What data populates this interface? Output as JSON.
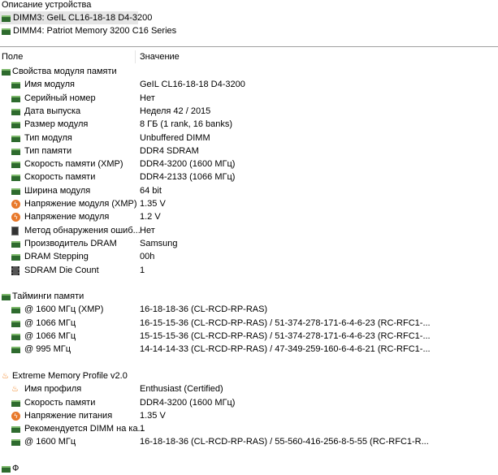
{
  "devices": {
    "title": "Описание устройства",
    "items": [
      "DIMM3: GeIL CL16-18-18 D4-3200",
      "DIMM4: Patriot Memory 3200 C16 Series"
    ],
    "selected": 0
  },
  "columns": {
    "field": "Поле",
    "value": "Значение"
  },
  "rows": [
    {
      "type": "sec",
      "icon": "ram",
      "field": "Свойства модуля памяти",
      "value": ""
    },
    {
      "type": "item",
      "icon": "ram",
      "field": "Имя модуля",
      "value": "GeIL CL16-18-18 D4-3200"
    },
    {
      "type": "item",
      "icon": "ram",
      "field": "Серийный номер",
      "value": "Нет"
    },
    {
      "type": "item",
      "icon": "ram",
      "field": "Дата выпуска",
      "value": "Неделя 42 / 2015"
    },
    {
      "type": "item",
      "icon": "ram",
      "field": "Размер модуля",
      "value": "8 ГБ (1 rank, 16 banks)"
    },
    {
      "type": "item",
      "icon": "ram",
      "field": "Тип модуля",
      "value": "Unbuffered DIMM"
    },
    {
      "type": "item",
      "icon": "ram",
      "field": "Тип памяти",
      "value": "DDR4 SDRAM"
    },
    {
      "type": "item",
      "icon": "ram",
      "field": "Скорость памяти (XMP)",
      "value": "DDR4-3200 (1600 МГц)"
    },
    {
      "type": "item",
      "icon": "ram",
      "field": "Скорость памяти",
      "value": "DDR4-2133 (1066 МГц)"
    },
    {
      "type": "item",
      "icon": "ram",
      "field": "Ширина модуля",
      "value": "64 bit"
    },
    {
      "type": "item",
      "icon": "bolt",
      "field": "Напряжение модуля (XMP)",
      "value": "1.35 V"
    },
    {
      "type": "item",
      "icon": "bolt",
      "field": "Напряжение модуля",
      "value": "1.2 V"
    },
    {
      "type": "item",
      "icon": "chip",
      "field": "Метод обнаружения ошиб...",
      "value": "Нет"
    },
    {
      "type": "item",
      "icon": "ram",
      "field": "Производитель DRAM",
      "value": "Samsung"
    },
    {
      "type": "item",
      "icon": "ram",
      "field": "DRAM Stepping",
      "value": "00h"
    },
    {
      "type": "item",
      "icon": "chip2",
      "field": "SDRAM Die Count",
      "value": "1"
    },
    {
      "type": "blank"
    },
    {
      "type": "sec",
      "icon": "ram",
      "field": "Тайминги памяти",
      "value": ""
    },
    {
      "type": "item",
      "icon": "ram",
      "field": "@ 1600 МГц (XMP)",
      "value": "16-18-18-36  (CL-RCD-RP-RAS)"
    },
    {
      "type": "item",
      "icon": "ram",
      "field": "@ 1066 МГц",
      "value": "16-15-15-36  (CL-RCD-RP-RAS) / 51-374-278-171-6-4-6-23  (RC-RFC1-..."
    },
    {
      "type": "item",
      "icon": "ram",
      "field": "@ 1066 МГц",
      "value": "15-15-15-36  (CL-RCD-RP-RAS) / 51-374-278-171-6-4-6-23  (RC-RFC1-..."
    },
    {
      "type": "item",
      "icon": "ram",
      "field": "@ 995 МГц",
      "value": "14-14-14-33  (CL-RCD-RP-RAS) / 47-349-259-160-6-4-6-21  (RC-RFC1-..."
    },
    {
      "type": "blank"
    },
    {
      "type": "sec",
      "icon": "flame",
      "field": "Extreme Memory Profile v2.0",
      "value": ""
    },
    {
      "type": "item",
      "icon": "flame",
      "field": "Имя профиля",
      "value": "Enthusiast (Certified)"
    },
    {
      "type": "item",
      "icon": "ram",
      "field": "Скорость памяти",
      "value": "DDR4-3200 (1600 МГц)"
    },
    {
      "type": "item",
      "icon": "bolt",
      "field": "Напряжение питания",
      "value": "1.35 V"
    },
    {
      "type": "item",
      "icon": "ram",
      "field": "Рекомендуется DIMM на ка...",
      "value": "1"
    },
    {
      "type": "item",
      "icon": "ram",
      "field": "@ 1600 МГц",
      "value": "16-18-18-36  (CL-RCD-RP-RAS) / 55-560-416-256-8-5-55  (RC-RFC1-R..."
    },
    {
      "type": "blank"
    },
    {
      "type": "sec",
      "icon": "ram",
      "field": "Ф",
      "value": ""
    }
  ]
}
